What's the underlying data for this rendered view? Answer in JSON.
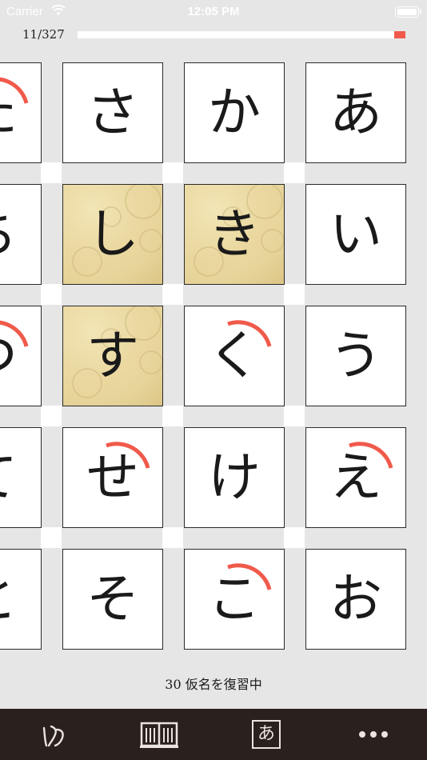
{
  "status_bar": {
    "carrier": "Carrier",
    "time": "12:05 PM"
  },
  "progress": {
    "label": "11/327",
    "fraction": 0.0336
  },
  "grid": {
    "columns": [
      {
        "cells": [
          {
            "kana": "あ",
            "state": "new",
            "arc": false
          },
          {
            "kana": "い",
            "state": "new",
            "arc": false
          },
          {
            "kana": "う",
            "state": "new",
            "arc": false
          },
          {
            "kana": "え",
            "state": "review",
            "arc": true
          },
          {
            "kana": "お",
            "state": "new",
            "arc": false
          }
        ]
      },
      {
        "cells": [
          {
            "kana": "か",
            "state": "new",
            "arc": false
          },
          {
            "kana": "き",
            "state": "learned",
            "arc": false
          },
          {
            "kana": "く",
            "state": "review",
            "arc": true
          },
          {
            "kana": "け",
            "state": "new",
            "arc": false
          },
          {
            "kana": "こ",
            "state": "review",
            "arc": true
          }
        ]
      },
      {
        "cells": [
          {
            "kana": "さ",
            "state": "new",
            "arc": false
          },
          {
            "kana": "し",
            "state": "learned",
            "arc": false
          },
          {
            "kana": "す",
            "state": "learned",
            "arc": false
          },
          {
            "kana": "せ",
            "state": "review",
            "arc": true
          },
          {
            "kana": "そ",
            "state": "new",
            "arc": false
          }
        ]
      },
      {
        "cells": [
          {
            "kana": "た",
            "state": "review",
            "arc": true
          },
          {
            "kana": "ち",
            "state": "new",
            "arc": false
          },
          {
            "kana": "つ",
            "state": "review",
            "arc": true
          },
          {
            "kana": "て",
            "state": "new",
            "arc": false
          },
          {
            "kana": "と",
            "state": "new",
            "arc": false
          }
        ]
      }
    ]
  },
  "review_status": "30 仮名を復習中",
  "tab_bar": {
    "tabs": [
      {
        "name": "practice",
        "icon": "brush-kana-icon"
      },
      {
        "name": "reference",
        "icon": "book-icon"
      },
      {
        "name": "kana-chart",
        "icon": "kana-box-icon",
        "glyph": "あ"
      },
      {
        "name": "more",
        "icon": "more-icon"
      }
    ]
  },
  "colors": {
    "accent": "#f05a4b",
    "tab_bar": "#2a201e",
    "background": "#e6e6e6",
    "learned": "#ead8a0"
  }
}
